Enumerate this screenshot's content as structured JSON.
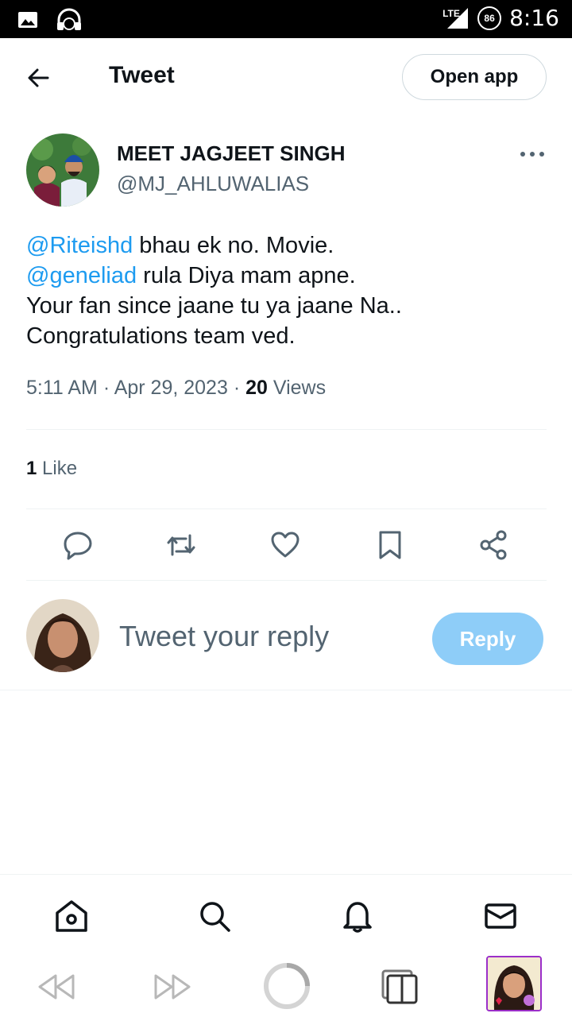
{
  "status_bar": {
    "time": "8:16",
    "network": "LTE",
    "battery": "86"
  },
  "header": {
    "title": "Tweet",
    "open_app_label": "Open app"
  },
  "tweet": {
    "author_name": "MEET JAGJEET SINGH",
    "author_handle": "@MJ_AHLUWALIAS",
    "mention_1": "@Riteishd",
    "text_1": " bhau ek no. Movie.",
    "mention_2": "@geneliad",
    "text_2": " rula Diya mam apne.",
    "text_3": "Your fan since jaane tu ya jaane Na..",
    "text_4": "Congratulations team ved.",
    "timestamp": "5:11 AM · Apr 29, 2023 · ",
    "views_count": "20",
    "views_label": " Views",
    "likes_count": "1",
    "likes_label": " Like"
  },
  "reply": {
    "placeholder": "Tweet your reply",
    "button_label": "Reply"
  },
  "icons": {
    "back": "arrow-left-icon",
    "more": "more-icon",
    "reply": "reply-icon",
    "retweet": "retweet-icon",
    "like": "heart-icon",
    "bookmark": "bookmark-icon",
    "share": "share-icon",
    "home": "home-icon",
    "search": "search-icon",
    "notifications": "bell-icon",
    "messages": "mail-icon"
  },
  "colors": {
    "accent": "#1d9bf0",
    "reply_button": "#8ecdf8",
    "text_secondary": "#536471"
  }
}
